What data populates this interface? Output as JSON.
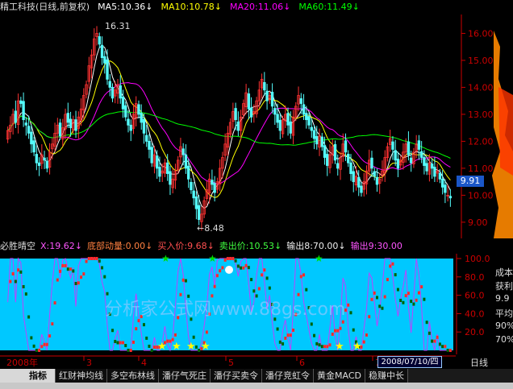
{
  "header": {
    "stock_name": "精工科技(日线,前复权)",
    "ma5": "MA5:10.36↓",
    "ma10": "MA10:10.78↓",
    "ma20": "MA20:11.06↓",
    "ma60": "MA60:11.49↓"
  },
  "colors": {
    "ma5": "#ffffff",
    "ma10": "#ffff00",
    "ma20": "#ff00ff",
    "ma60": "#00ff00",
    "up": "#ff3232",
    "down": "#54fcfc",
    "panel_bg": "#00c8ff"
  },
  "price_axis": [
    "16.00",
    "15.00",
    "14.00",
    "13.00",
    "12.00",
    "11.00",
    "10.00",
    "9.00"
  ],
  "price_annotations": {
    "high": "16.31",
    "low": "←8.48",
    "current": "9.91"
  },
  "indicator": {
    "name": "必胜晴空",
    "x": "X:19.62↓",
    "bottom_power": "底部动量:0.00↓",
    "buy_price": "买入价:9.68↓",
    "sell_price": "卖出价:10.53↓",
    "out1": "输出8:70.00↓",
    "out2": "输出9:30.00"
  },
  "indicator_axis": [
    "100.0",
    "80.0",
    "60.0",
    "40.0",
    "20.0"
  ],
  "time_axis": {
    "year": "2008年",
    "months": [
      "3",
      "4",
      "5",
      "6",
      "7"
    ],
    "date": "2008/07/10/四",
    "label": "日线"
  },
  "right_labels": [
    "成本",
    "获利",
    "9.9",
    "平均",
    "90%",
    "70%"
  ],
  "watermark": "分析家公式网www.88gs.com",
  "tabs": [
    "指标",
    "红财神均线",
    "多空布林线",
    "潘仔气死庄",
    "潘仔买卖令",
    "潘仔竞虹令",
    "黄金MACD",
    "稳赚中长"
  ],
  "chart_data": {
    "type": "candlestick",
    "ylim": [
      8.4,
      16.7
    ],
    "x": [
      1,
      2,
      3,
      4,
      5,
      6,
      7,
      8,
      9,
      10,
      11,
      12,
      13,
      14,
      15,
      16,
      17,
      18,
      19,
      20,
      21,
      22,
      23,
      24,
      25,
      26,
      27,
      28,
      29,
      30,
      31,
      32,
      33,
      34,
      35,
      36,
      37,
      38,
      39,
      40,
      41,
      42,
      43,
      44,
      45,
      46,
      47,
      48,
      49,
      50,
      51,
      52,
      53,
      54,
      55,
      56,
      57,
      58,
      59,
      60,
      61,
      62,
      63,
      64,
      65,
      66,
      67,
      68,
      69,
      70,
      71,
      72,
      73,
      74,
      75,
      76,
      77,
      78,
      79,
      80,
      81,
      82,
      83,
      84,
      85,
      86,
      87,
      88,
      89,
      90,
      91,
      92,
      93,
      94,
      95,
      96,
      97,
      98,
      99,
      100,
      101,
      102,
      103,
      104,
      105,
      106,
      107,
      108,
      109,
      110,
      111,
      112,
      113,
      114,
      115,
      116,
      117,
      118,
      119,
      120,
      121,
      122,
      123,
      124,
      125,
      126,
      127,
      128,
      129,
      130,
      131,
      132,
      133,
      134,
      135,
      136,
      137,
      138,
      139,
      140,
      141,
      142,
      143,
      144,
      145,
      146,
      147,
      148,
      149,
      150,
      151,
      152,
      153,
      154,
      155,
      156,
      157,
      158,
      159,
      160,
      161,
      162,
      163,
      164,
      165,
      166,
      167,
      168,
      169,
      170
    ],
    "close": [
      12.4,
      12.6,
      13.0,
      12.7,
      13.5,
      13.4,
      12.8,
      12.6,
      12.3,
      11.9,
      11.6,
      11.2,
      11.1,
      11.5,
      11.3,
      11.0,
      11.6,
      11.9,
      12.3,
      12.6,
      12.2,
      12.5,
      13.0,
      12.7,
      12.5,
      12.8,
      12.4,
      12.9,
      13.2,
      13.7,
      14.1,
      14.8,
      15.2,
      15.8,
      16.0,
      15.6,
      15.1,
      14.9,
      14.3,
      14.0,
      13.6,
      13.9,
      14.1,
      13.6,
      13.2,
      12.9,
      12.6,
      12.4,
      13.0,
      13.4,
      13.0,
      12.7,
      12.3,
      12.0,
      11.7,
      11.2,
      11.5,
      11.0,
      10.7,
      10.9,
      11.2,
      10.8,
      10.4,
      10.6,
      10.9,
      11.3,
      11.8,
      11.5,
      11.0,
      10.6,
      10.2,
      9.9,
      9.5,
      9.1,
      9.3,
      9.8,
      10.2,
      10.6,
      10.4,
      10.1,
      10.5,
      11.0,
      11.4,
      11.9,
      12.3,
      12.7,
      13.1,
      12.8,
      12.4,
      12.9,
      13.4,
      13.8,
      13.2,
      12.9,
      13.1,
      13.5,
      13.9,
      14.3,
      13.9,
      13.5,
      13.7,
      13.3,
      13.0,
      12.7,
      12.4,
      12.8,
      13.0,
      12.6,
      12.3,
      12.9,
      13.3,
      13.7,
      13.4,
      13.0,
      12.8,
      12.6,
      12.4,
      12.1,
      11.9,
      12.2,
      11.8,
      11.4,
      11.1,
      11.5,
      11.8,
      11.3,
      11.0,
      11.4,
      11.9,
      11.6,
      11.2,
      10.8,
      10.5,
      10.7,
      10.3,
      10.1,
      10.5,
      10.9,
      11.3,
      11.0,
      10.7,
      10.4,
      10.6,
      10.9,
      11.4,
      11.8,
      12.1,
      11.7,
      11.3,
      11.0,
      11.3,
      11.6,
      11.9,
      11.5,
      11.2,
      11.6,
      11.9,
      11.7,
      11.4,
      11.1,
      10.9,
      11.2,
      11.0,
      10.7,
      10.9,
      10.6,
      10.3,
      10.1,
      10.0,
      9.9
    ],
    "high_annotation": 16.31,
    "low_annotation": 8.48,
    "indicator_ylim": [
      0,
      100
    ]
  }
}
